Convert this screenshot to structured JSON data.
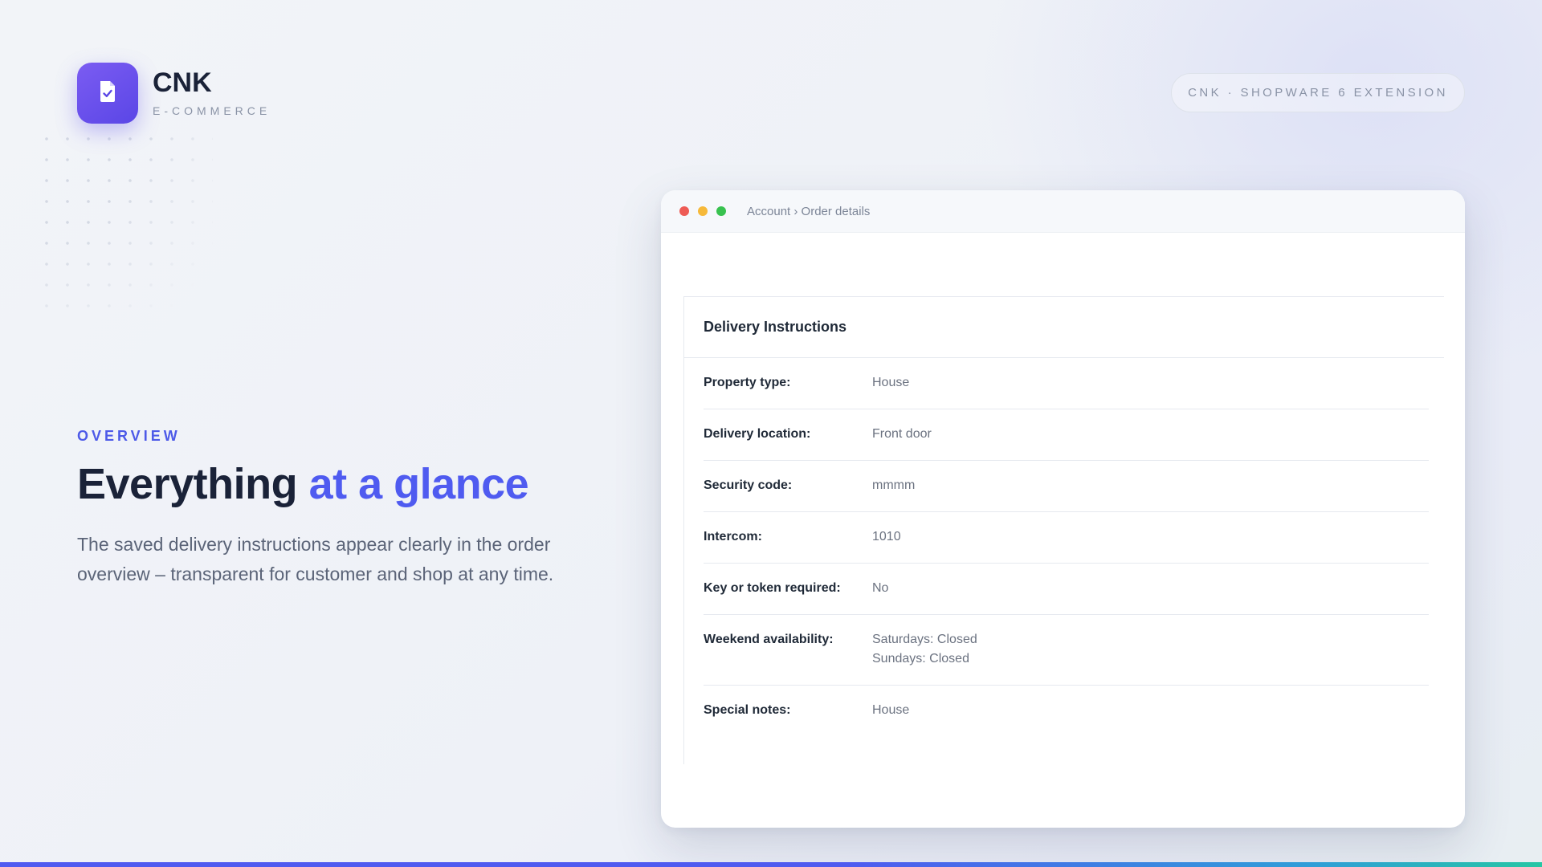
{
  "brand": {
    "name": "CNK",
    "subtitle": "E-COMMERCE",
    "icon": "document-check-icon"
  },
  "badge": "CNK · SHOPWARE 6 EXTENSION",
  "hero": {
    "eyebrow": "OVERVIEW",
    "headline_main": "Everything",
    "headline_accent": "at a glance",
    "description": "The saved delivery instructions appear clearly in the order overview – transparent for customer and shop at any time."
  },
  "window": {
    "breadcrumb": "Account › Order details",
    "panel_title": "Delivery Instructions",
    "rows": [
      {
        "label": "Property type:",
        "value": "House"
      },
      {
        "label": "Delivery location:",
        "value": "Front door"
      },
      {
        "label": "Security code:",
        "value": "mmmm"
      },
      {
        "label": "Intercom:",
        "value": "1010"
      },
      {
        "label": "Key or token required:",
        "value": "No"
      },
      {
        "label": "Weekend availability:",
        "value": "Saturdays: Closed",
        "value2": "Sundays: Closed"
      },
      {
        "label": "Special notes:",
        "value": "House"
      }
    ]
  },
  "colors": {
    "accent": "#4f5bf0",
    "logo": "#6a52ec",
    "heading": "#1a2238",
    "traffic_red": "#ee5b55",
    "traffic_yellow": "#f6b93a",
    "traffic_green": "#38c24f"
  }
}
